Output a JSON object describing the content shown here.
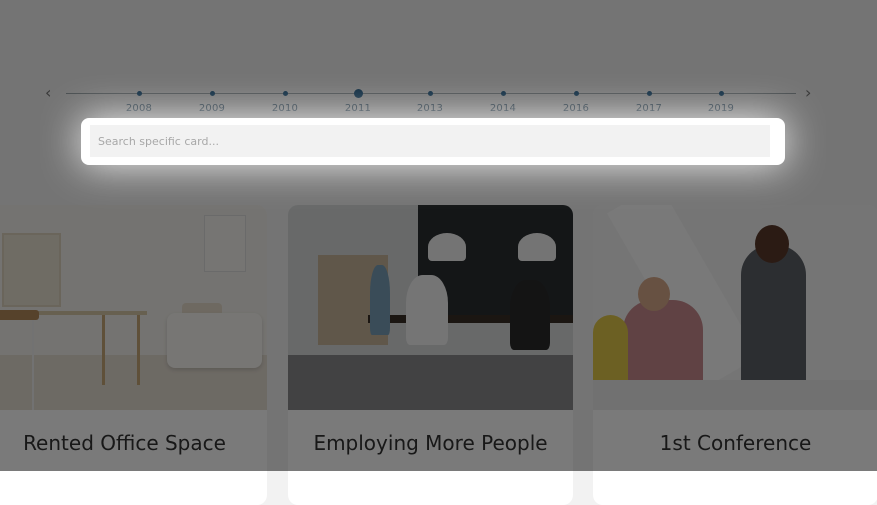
{
  "timeline": {
    "prev_icon": "chevron-left-icon",
    "next_icon": "chevron-right-icon",
    "years": [
      "2008",
      "2009",
      "2010",
      "2011",
      "2013",
      "2014",
      "2016",
      "2017",
      "2019"
    ],
    "active_year": "2011"
  },
  "search": {
    "placeholder": "Search specific card..."
  },
  "cards": [
    {
      "title": "Rented Office Space"
    },
    {
      "title": "Employing More People"
    },
    {
      "title": "1st Conference"
    }
  ],
  "colors": {
    "accent": "#1f5a86",
    "overlay": "rgba(0,0,0,0.52)"
  }
}
